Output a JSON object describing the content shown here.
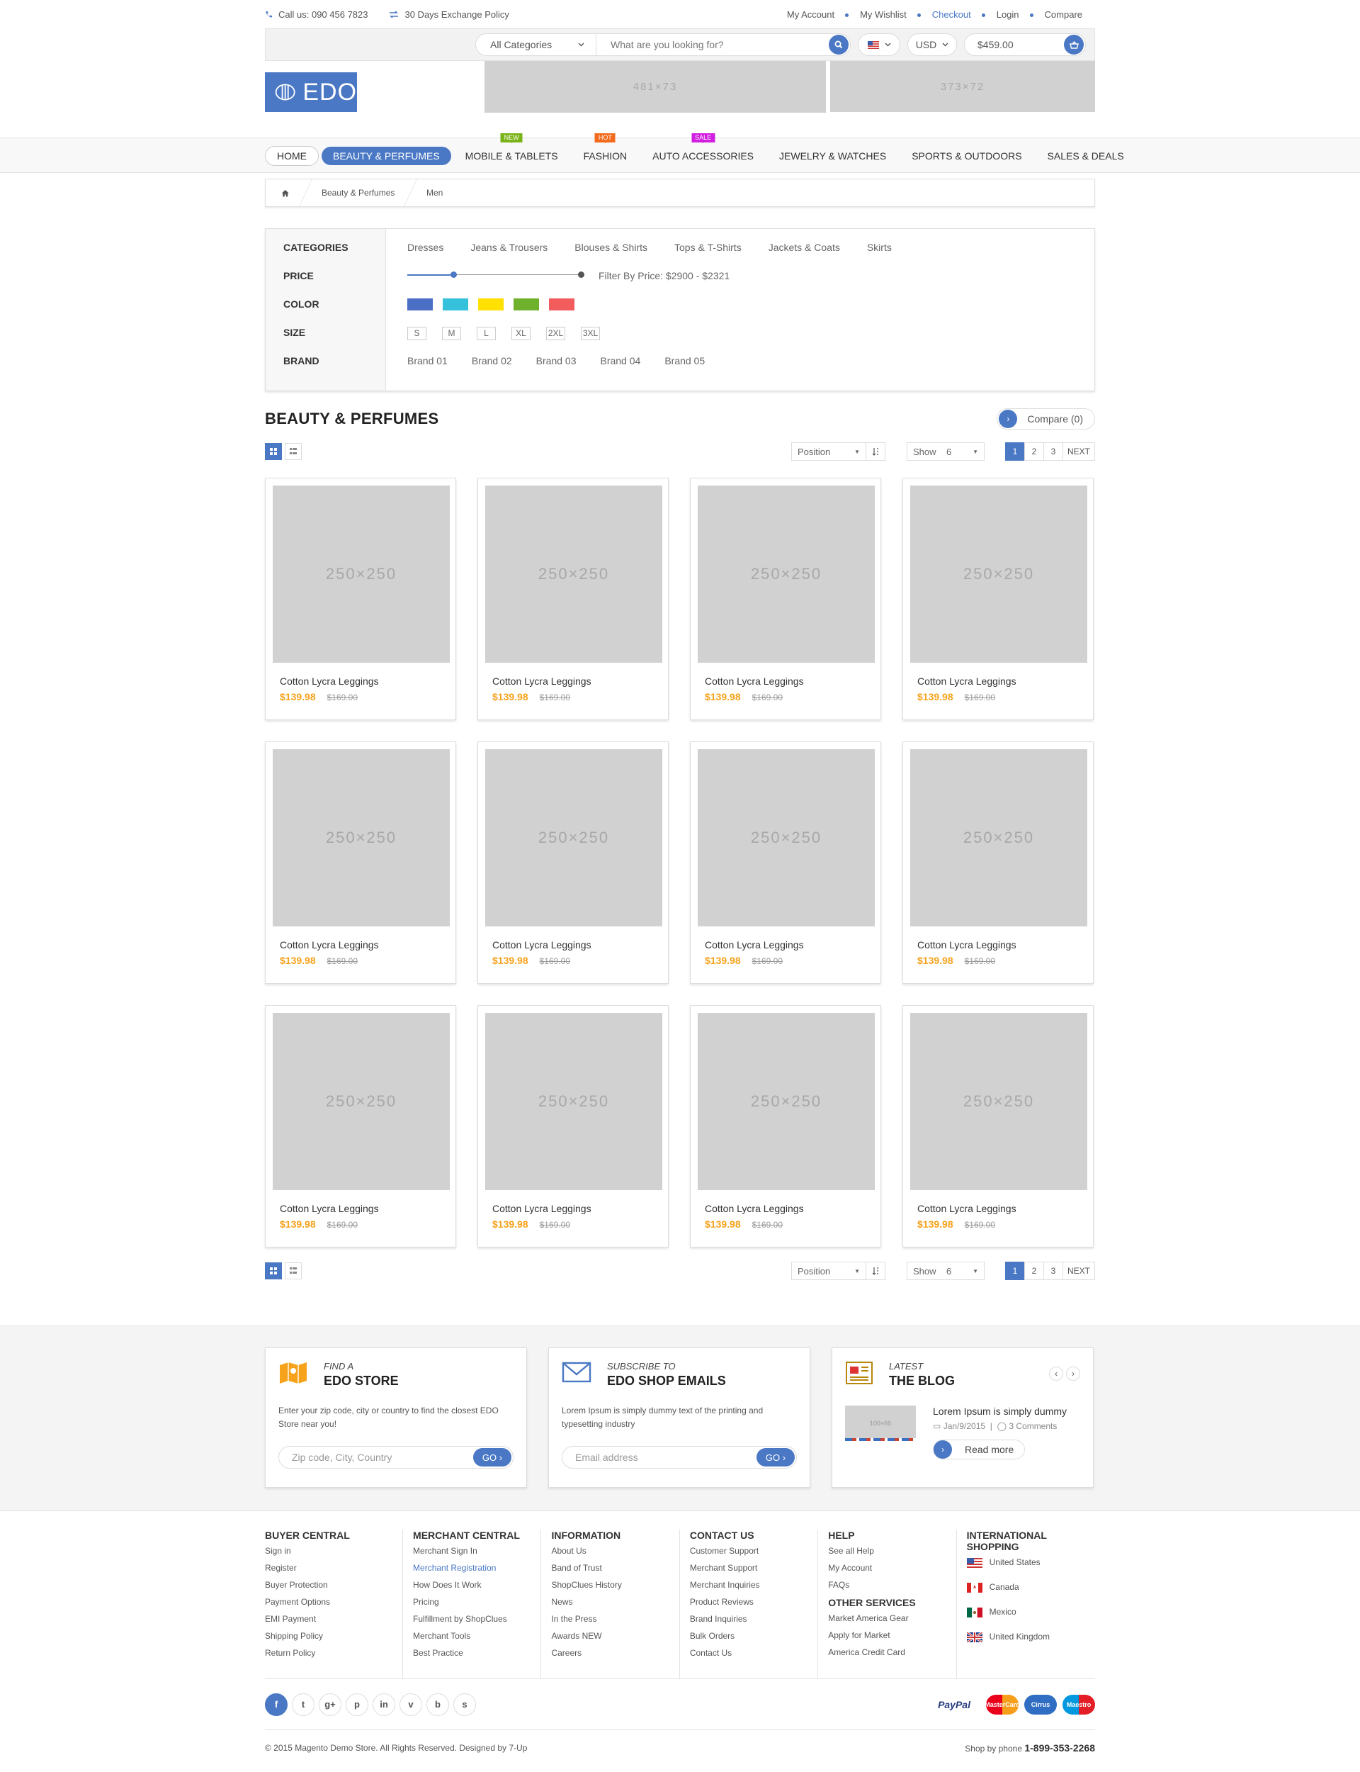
{
  "topbar": {
    "phone": "Call us: 090 456 7823",
    "exchange": "30 Days Exchange Policy",
    "links": [
      "My Account",
      "My Wishlist",
      "Checkout",
      "Login",
      "Compare"
    ]
  },
  "search": {
    "category": "All Categories",
    "placeholder": "What are you looking for?",
    "currency": "USD",
    "cart_total": "$459.00"
  },
  "logo": {
    "text": "EDO"
  },
  "banners": [
    "481×73",
    "373×72"
  ],
  "nav": {
    "items": [
      {
        "label": "HOME",
        "tag": ""
      },
      {
        "label": "BEAUTY & PERFUMES",
        "tag": ""
      },
      {
        "label": "MOBILE & TABLETS",
        "tag": "NEW",
        "tag_color": "#7ab317"
      },
      {
        "label": "FASHION",
        "tag": "HOT",
        "tag_color": "#f26a1b"
      },
      {
        "label": "AUTO ACCESSORIES",
        "tag": "SALE",
        "tag_color": "#d21ee0"
      },
      {
        "label": "JEWELRY & WATCHES",
        "tag": ""
      },
      {
        "label": "SPORTS & OUTDOORS",
        "tag": ""
      },
      {
        "label": "SALES & DEALS",
        "tag": ""
      }
    ]
  },
  "breadcrumb": [
    "Beauty & Perfumes",
    "Men"
  ],
  "filter": {
    "labels": [
      "CATEGORIES",
      "PRICE",
      "COLOR",
      "SIZE",
      "BRAND"
    ],
    "categories": [
      "Dresses",
      "Jeans & Trousers",
      "Blouses & Shirts",
      "Tops & T-Shirts",
      "Jackets & Coats",
      "Skirts"
    ],
    "price_text": "Filter By Price: $2900  -  $2321",
    "price_handle_fraction": 0.26,
    "colors": [
      "#4a6fc4",
      "#35c0dc",
      "#ffe000",
      "#6fb12d",
      "#f25c5c"
    ],
    "sizes": [
      "S",
      "M",
      "L",
      "XL",
      "2XL",
      "3XL"
    ],
    "brands": [
      "Brand 01",
      "Brand 02",
      "Brand 03",
      "Brand 04",
      "Brand 05"
    ]
  },
  "section": {
    "title": "BEAUTY & PERFUMES",
    "compare": "Compare (0)",
    "sort": "Position",
    "show_label": "Show",
    "show_value": "6",
    "pages": [
      "1",
      "2",
      "3",
      "NEXT"
    ]
  },
  "products": [
    {
      "img": "250×250",
      "name": "Cotton Lycra Leggings",
      "price": "$139.98",
      "old": "$169.00"
    },
    {
      "img": "250×250",
      "name": "Cotton Lycra Leggings",
      "price": "$139.98",
      "old": "$169.00"
    },
    {
      "img": "250×250",
      "name": "Cotton Lycra Leggings",
      "price": "$139.98",
      "old": "$169.00"
    },
    {
      "img": "250×250",
      "name": "Cotton Lycra Leggings",
      "price": "$139.98",
      "old": "$169.00"
    },
    {
      "img": "250×250",
      "name": "Cotton Lycra Leggings",
      "price": "$139.98",
      "old": "$169.00"
    },
    {
      "img": "250×250",
      "name": "Cotton Lycra Leggings",
      "price": "$139.98",
      "old": "$169.00"
    },
    {
      "img": "250×250",
      "name": "Cotton Lycra Leggings",
      "price": "$139.98",
      "old": "$169.00"
    },
    {
      "img": "250×250",
      "name": "Cotton Lycra Leggings",
      "price": "$139.98",
      "old": "$169.00"
    },
    {
      "img": "250×250",
      "name": "Cotton Lycra Leggings",
      "price": "$139.98",
      "old": "$169.00"
    },
    {
      "img": "250×250",
      "name": "Cotton Lycra Leggings",
      "price": "$139.98",
      "old": "$169.00"
    },
    {
      "img": "250×250",
      "name": "Cotton Lycra Leggings",
      "price": "$139.98",
      "old": "$169.00"
    },
    {
      "img": "250×250",
      "name": "Cotton Lycra Leggings",
      "price": "$139.98",
      "old": "$169.00"
    }
  ],
  "services": {
    "store": {
      "small": "FIND A",
      "big": "EDO STORE",
      "desc": "Enter your zip code, city or country to find the closest EDO Store near you!",
      "placeholder": "Zip code, City, Country",
      "go": "GO ›"
    },
    "email": {
      "small": "SUBSCRIBE TO",
      "big": "EDO SHOP EMAILS",
      "desc": "Lorem Ipsum is simply dummy text of the printing and typesetting industry",
      "placeholder": "Email address",
      "go": "GO ›"
    },
    "blog": {
      "small": "LATEST",
      "big": "THE BLOG",
      "thumb": "100×66",
      "post_title": "Lorem Ipsum is simply dummy",
      "date": "Jan/9/2015",
      "comments": "3 Comments",
      "read_more": "Read more"
    }
  },
  "footer": {
    "columns": [
      {
        "title": "BUYER CENTRAL",
        "items": [
          "Sign in",
          "Register",
          "Buyer Protection",
          "Payment Options",
          "EMI Payment",
          "Shipping Policy",
          "Return Policy"
        ]
      },
      {
        "title": "MERCHANT CENTRAL",
        "items": [
          "Merchant Sign In",
          "Merchant Registration",
          "How Does It Work",
          "Pricing",
          "Fulfillment by ShopClues",
          "Merchant Tools",
          "Best Practice"
        ]
      },
      {
        "title": "INFORMATION",
        "items": [
          "About Us",
          "Band of Trust",
          "ShopClues History",
          "News",
          "In the Press",
          "Awards NEW",
          "Careers"
        ]
      },
      {
        "title": "CONTACT US",
        "items": [
          "Customer Support",
          "Merchant Support",
          "Merchant Inquiries",
          "Product Reviews",
          "Brand Inquiries",
          "Bulk Orders",
          "Contact Us"
        ]
      },
      {
        "title": "HELP",
        "items": [
          "See all Help",
          "My Account",
          "FAQs"
        ],
        "title2": "OTHER SERVICES",
        "items2": [
          "Market America Gear",
          "Apply for Market",
          "America Credit Card"
        ]
      },
      {
        "title": "INTERNATIONAL SHOPPING",
        "items": [
          "United States",
          "Canada",
          "Mexico",
          "United Kingdom"
        ]
      }
    ],
    "social": [
      "f",
      "t",
      "g+",
      "p",
      "in",
      "v",
      "b",
      "s"
    ],
    "payments": [
      "PayPal",
      "MasterCard",
      "Cirrus",
      "Maestro"
    ],
    "copyright": "© 2015 Magento Demo Store. All Rights Reserved. Designed by 7-Up",
    "phone_label": "Shop by phone",
    "phone": "1-899-353-2268"
  }
}
